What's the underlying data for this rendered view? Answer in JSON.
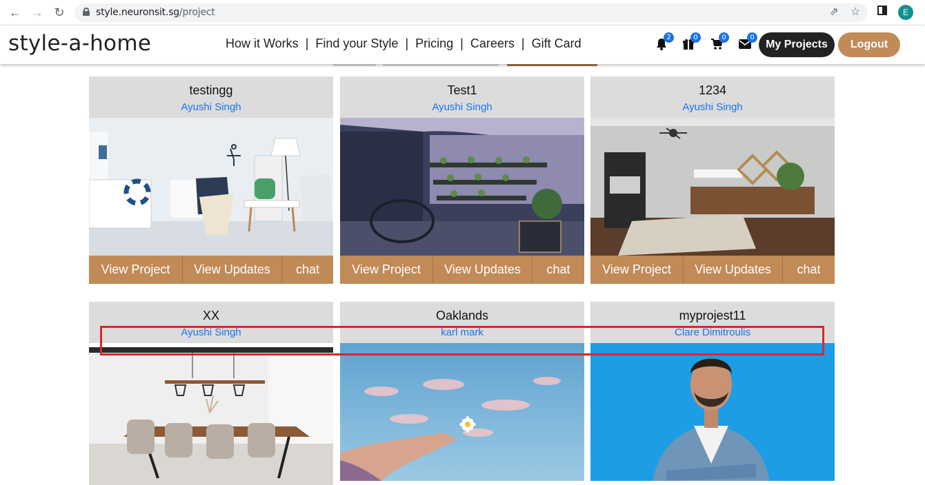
{
  "browser": {
    "url_host": "style.neuronsit.sg",
    "url_path": "/project",
    "profile_initial": "E"
  },
  "site": {
    "logo": "style-a-home",
    "nav": [
      "How it Works",
      "Find your Style",
      "Pricing",
      "Careers",
      "Gift Card"
    ],
    "badges": {
      "notifications": "2",
      "gifts": "0",
      "cart": "0",
      "messages": "0"
    },
    "my_projects_label": "My Projects",
    "logout_label": "Logout"
  },
  "projects": [
    {
      "title": "testingg",
      "owner": "Ayushi Singh",
      "image": "white-nautical-nursery"
    },
    {
      "title": "Test1",
      "owner": "Ayushi Singh",
      "image": "night-balcony-planters"
    },
    {
      "title": "1234",
      "owner": "Ayushi Singh",
      "image": "entryway-console"
    },
    {
      "title": "XX",
      "owner": "Ayushi Singh",
      "image": "dining-room-pendant"
    },
    {
      "title": "Oaklands",
      "owner": "karl mark",
      "image": "sky-daisy-hand"
    },
    {
      "title": "myprojest11",
      "owner": "Clare Dimitroulis",
      "image": "man-denim-blue-background"
    }
  ],
  "actions": {
    "view_project": "View Project",
    "view_updates": "View Updates",
    "chat": "chat"
  },
  "colors": {
    "accent": "#c18a57",
    "card_head": "#dcdcdc",
    "link": "#1a73e8",
    "highlight": "#e0242c"
  }
}
